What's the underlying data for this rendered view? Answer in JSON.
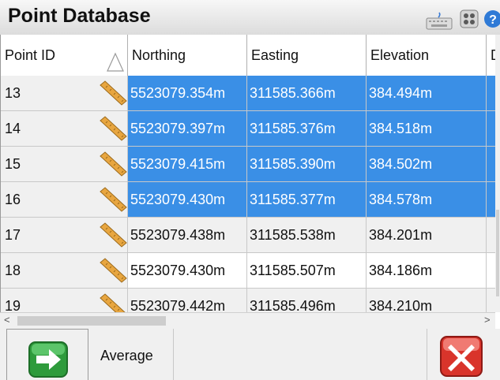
{
  "title": "Point Database",
  "icons": {
    "keyboard": "keyboard-icon",
    "menu": "grid-menu-icon",
    "help": "help-icon"
  },
  "columns": [
    "Point ID",
    "Northing",
    "Easting",
    "Elevation",
    "D"
  ],
  "rows": [
    {
      "id": "13",
      "northing": "5523079.354m",
      "easting": "311585.366m",
      "elevation": "384.494m",
      "selected": true
    },
    {
      "id": "14",
      "northing": "5523079.397m",
      "easting": "311585.376m",
      "elevation": "384.518m",
      "selected": true
    },
    {
      "id": "15",
      "northing": "5523079.415m",
      "easting": "311585.390m",
      "elevation": "384.502m",
      "selected": true
    },
    {
      "id": "16",
      "northing": "5523079.430m",
      "easting": "311585.377m",
      "elevation": "384.578m",
      "selected": true
    },
    {
      "id": "17",
      "northing": "5523079.438m",
      "easting": "311585.538m",
      "elevation": "384.201m",
      "selected": false
    },
    {
      "id": "18",
      "northing": "5523079.430m",
      "easting": "311585.507m",
      "elevation": "384.186m",
      "selected": false
    },
    {
      "id": "19",
      "northing": "5523079.442m",
      "easting": "311585.496m",
      "elevation": "384.210m",
      "selected": false
    }
  ],
  "footer": {
    "average_label": "Average"
  },
  "colors": {
    "selection": "#3a8fe6",
    "accept": "#2e9b3c",
    "cancel": "#d9342b"
  }
}
